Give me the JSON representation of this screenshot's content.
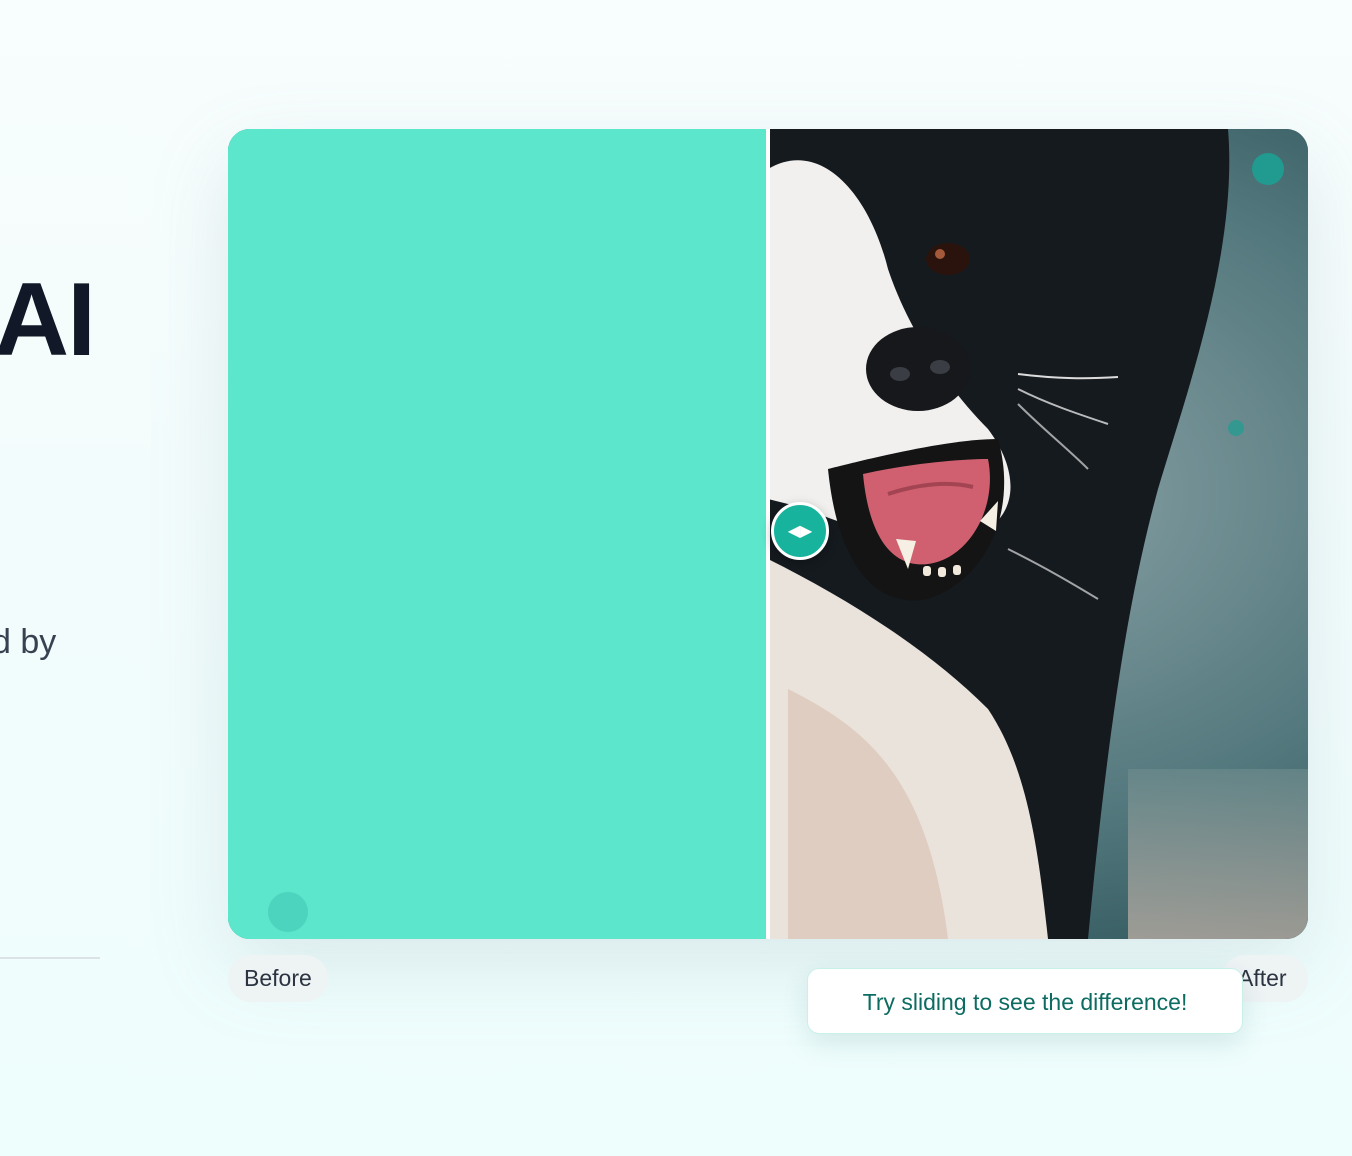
{
  "hero": {
    "title_fragment": "AI",
    "subtitle_fragment": "d by"
  },
  "comparison": {
    "before_label": "Before",
    "after_label": "After",
    "slider_position": 0.5,
    "handle_icon": "left-right-arrows-icon",
    "tooltip_text": "Try sliding to see the difference!"
  },
  "colors": {
    "accent": "#17b39c",
    "pattern_light": "#5ce6cc",
    "pattern_dark": "#1bbf7a",
    "tooltip_text": "#0c6c61"
  }
}
